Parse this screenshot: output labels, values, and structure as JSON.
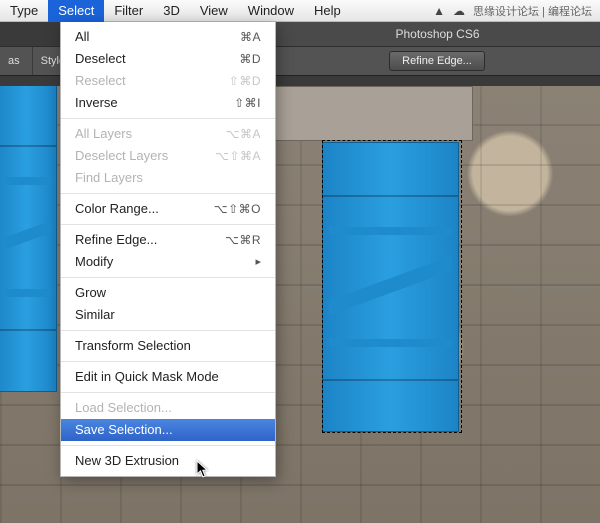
{
  "menubar": {
    "items": [
      "Type",
      "Select",
      "Filter",
      "3D",
      "View",
      "Window",
      "Help"
    ],
    "active_index": 1,
    "right_text": "思缘设计论坛 | 编程论坛"
  },
  "app_title": "Photoshop CS6",
  "options_bar": {
    "feather_label": "as",
    "style_label": "Style:",
    "refine_btn": "Refine Edge..."
  },
  "select_menu": {
    "groups": [
      [
        {
          "label": "All",
          "shortcut": "⌘A",
          "disabled": false
        },
        {
          "label": "Deselect",
          "shortcut": "⌘D",
          "disabled": false
        },
        {
          "label": "Reselect",
          "shortcut": "⇧⌘D",
          "disabled": true
        },
        {
          "label": "Inverse",
          "shortcut": "⇧⌘I",
          "disabled": false
        }
      ],
      [
        {
          "label": "All Layers",
          "shortcut": "⌥⌘A",
          "disabled": true
        },
        {
          "label": "Deselect Layers",
          "shortcut": "⌥⇧⌘A",
          "disabled": true
        },
        {
          "label": "Find Layers",
          "shortcut": "",
          "disabled": true
        }
      ],
      [
        {
          "label": "Color Range...",
          "shortcut": "⌥⇧⌘O",
          "disabled": false
        }
      ],
      [
        {
          "label": "Refine Edge...",
          "shortcut": "⌥⌘R",
          "disabled": false
        },
        {
          "label": "Modify",
          "shortcut": "",
          "disabled": false,
          "submenu": true
        }
      ],
      [
        {
          "label": "Grow",
          "shortcut": "",
          "disabled": false
        },
        {
          "label": "Similar",
          "shortcut": "",
          "disabled": false
        }
      ],
      [
        {
          "label": "Transform Selection",
          "shortcut": "",
          "disabled": false
        }
      ],
      [
        {
          "label": "Edit in Quick Mask Mode",
          "shortcut": "",
          "disabled": false
        }
      ],
      [
        {
          "label": "Load Selection...",
          "shortcut": "",
          "disabled": true
        },
        {
          "label": "Save Selection...",
          "shortcut": "",
          "disabled": false,
          "highlight": true
        }
      ],
      [
        {
          "label": "New 3D Extrusion",
          "shortcut": "",
          "disabled": false
        }
      ]
    ]
  }
}
